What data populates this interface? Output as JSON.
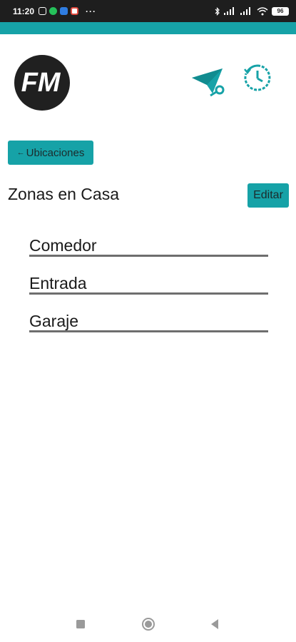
{
  "status_bar": {
    "time": "11:20",
    "more": "···",
    "battery": "96"
  },
  "header": {
    "logo_text": "FM",
    "send_icon": "paper-plane-key-icon",
    "history_icon": "clock-history-icon"
  },
  "nav": {
    "back_label": "Ubicaciones",
    "back_arrow": "←"
  },
  "section": {
    "title": "Zonas en Casa",
    "edit_label": "Editar"
  },
  "zones": [
    {
      "name": "Comedor"
    },
    {
      "name": "Entrada"
    },
    {
      "name": "Garaje"
    }
  ],
  "colors": {
    "accent": "#16a2a7",
    "status_bar": "#1e1e1e"
  }
}
